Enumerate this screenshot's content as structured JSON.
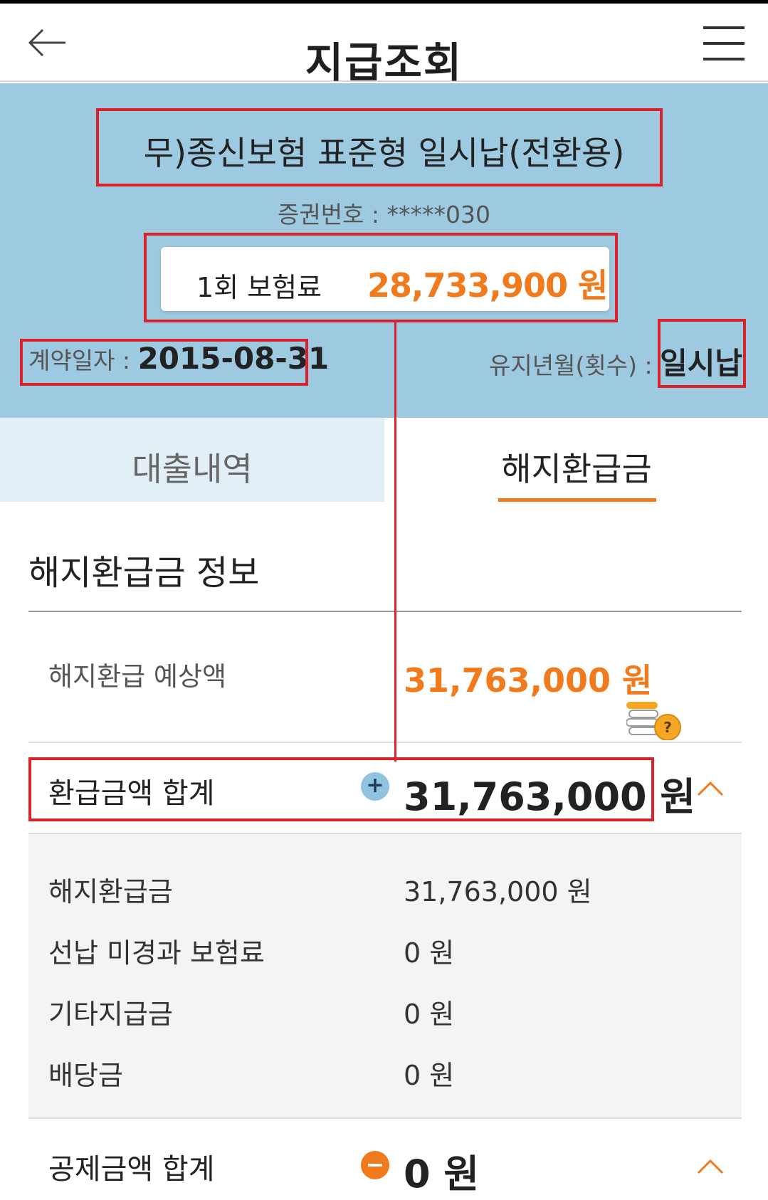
{
  "header": {
    "title": "지급조회",
    "back_icon": "arrow-left-icon",
    "menu_icon": "hamburger-menu-icon"
  },
  "summary": {
    "product_name": "무)종신보험 표준형 일시납(전환용)",
    "policy_number_label": "증권번호 :",
    "policy_number": "*****030",
    "premium_label": "1회 보험료",
    "premium_value": "28,733,900 원",
    "contract_date_label": "계약일자 :",
    "contract_date": "2015-08-31",
    "maintain_label": "유지년월(횟수) :",
    "maintain_value": "일시납"
  },
  "tabs": [
    {
      "label": "대출내역",
      "active": false
    },
    {
      "label": "해지환급금",
      "active": true
    }
  ],
  "refund_info": {
    "section_title": "해지환급금 정보",
    "estimate_label": "해지환급 예상액",
    "estimate_value": "31,763,000 원",
    "estimate_help_icon": "coin-question-icon",
    "refund_total": {
      "label": "환급금액 합계",
      "value": "31,763,000 원",
      "icon": "plus-circle-icon",
      "toggle_icon": "chevron-up-icon"
    },
    "details": [
      {
        "label": "해지환급금",
        "value": "31,763,000 원"
      },
      {
        "label": "선납 미경과 보험료",
        "value": "0 원"
      },
      {
        "label": "기타지급금",
        "value": "0 원"
      },
      {
        "label": "배당금",
        "value": "0 원"
      }
    ],
    "deduction_total": {
      "label": "공제금액 합계",
      "value": "0 원",
      "icon": "minus-circle-icon",
      "toggle_icon": "chevron-up-icon"
    }
  },
  "colors": {
    "accent": "#f07a1c",
    "summary_bg": "#9ecae1",
    "highlight": "#d9222a"
  }
}
